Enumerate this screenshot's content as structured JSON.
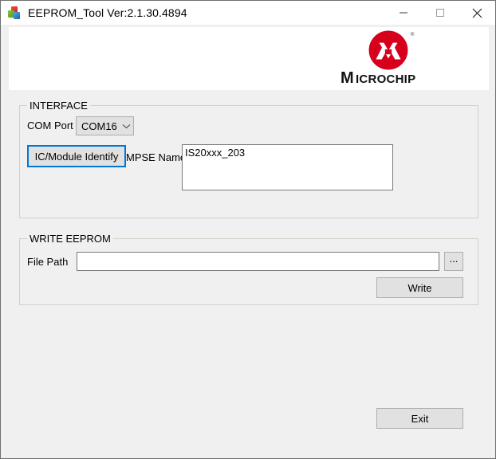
{
  "window": {
    "title": "EEPROM_Tool Ver:2.1.30.4894",
    "icon": "app-icon",
    "controls": {
      "minimize": "minimize-icon",
      "maximize": "maximize-icon",
      "close": "close-icon"
    }
  },
  "branding": {
    "wordmark": "MICROCHIP",
    "registered_mark": "®",
    "logo_color": "#d6001c"
  },
  "interface_group": {
    "title": "INTERFACE",
    "com_port_label": "COM Port",
    "com_port_value": "COM16",
    "com_port_chevron": "chevron-down-icon",
    "identify_button": "IC/Module Identify",
    "identify_button_focus_color": "#0078d7",
    "mpse_label": "MPSE Name:",
    "mpse_value": "IS20xxx_203"
  },
  "write_group": {
    "title": "WRITE EEPROM",
    "file_path_label": "File Path",
    "file_path_value": "",
    "file_path_placeholder": "",
    "browse_button": "...",
    "write_button": "Write"
  },
  "footer": {
    "exit_button": "Exit"
  }
}
